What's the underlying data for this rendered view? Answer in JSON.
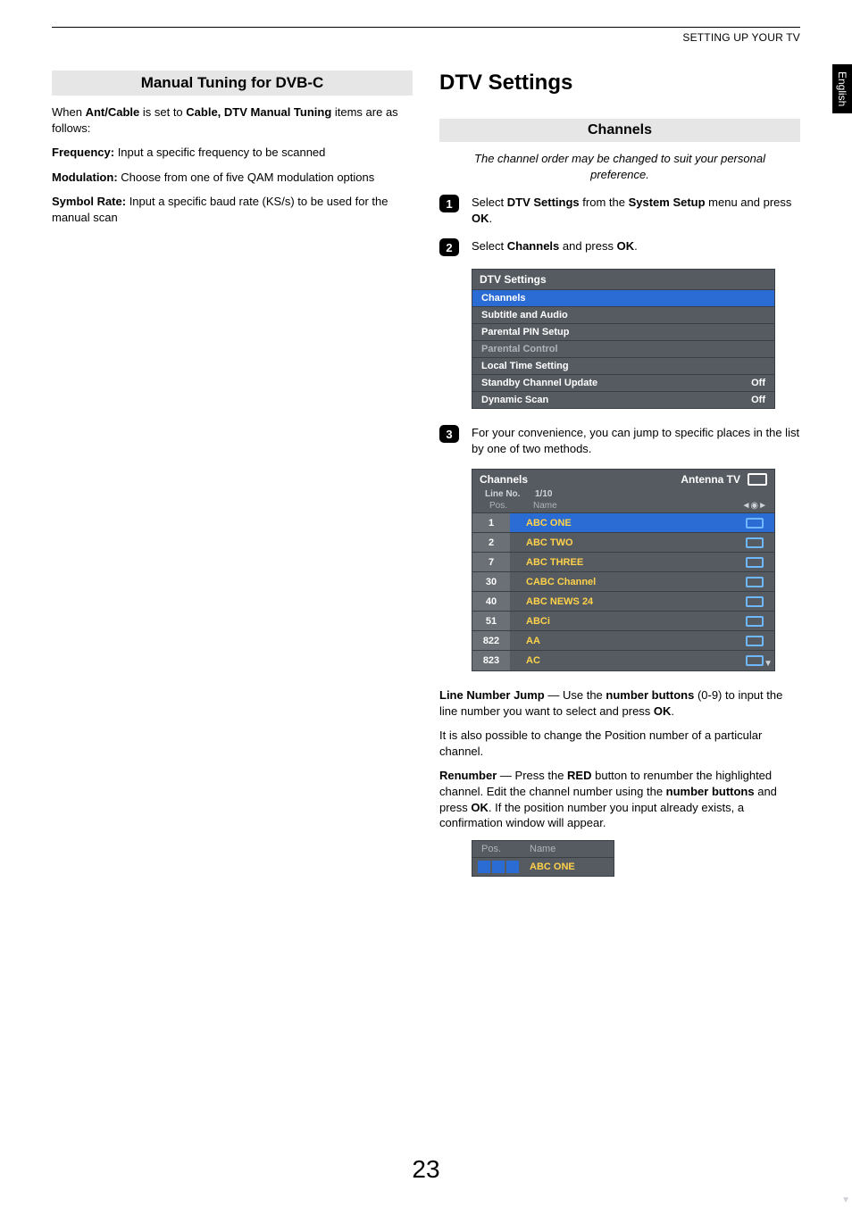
{
  "running_head": "SETTING UP YOUR TV",
  "lang_tab": "English",
  "page_number": "23",
  "left": {
    "section_title": "Manual Tuning for DVB-C",
    "intro_a": "When ",
    "intro_b": "Ant/Cable",
    "intro_c": " is set to ",
    "intro_d": "Cable, DTV Manual Tuning",
    "intro_e": " items are as follows:",
    "freq_label": "Frequency:",
    "freq_text": " Input a specific frequency to be scanned",
    "mod_label": "Modulation:",
    "mod_text": " Choose from one of five QAM modulation options",
    "sym_label": "Symbol Rate:",
    "sym_text": " Input a specific baud rate (KS/s) to be used for the manual scan"
  },
  "right": {
    "h1": "DTV Settings",
    "channels_title": "Channels",
    "intro_italic": "The channel order may be changed to suit your personal preference.",
    "step1_a": "Select ",
    "step1_b": "DTV Settings",
    "step1_c": " from the ",
    "step1_d": "System Setup",
    "step1_e": " menu and press ",
    "step1_f": "OK",
    "step1_g": ".",
    "step2_a": "Select ",
    "step2_b": "Channels",
    "step2_c": " and press ",
    "step2_d": "OK",
    "step2_e": ".",
    "osd1": {
      "title": "DTV Settings",
      "rows": [
        {
          "label": "Channels",
          "value": "",
          "sel": true
        },
        {
          "label": "Subtitle and Audio",
          "value": ""
        },
        {
          "label": "Parental PIN Setup",
          "value": ""
        },
        {
          "label": "Parental Control",
          "value": "",
          "dim": true
        },
        {
          "label": "Local Time Setting",
          "value": ""
        },
        {
          "label": "Standby Channel Update",
          "value": "Off"
        },
        {
          "label": "Dynamic Scan",
          "value": "Off"
        }
      ]
    },
    "step3_text": "For your convenience, you can jump to specific places in the list by one of two methods.",
    "osd2": {
      "title_left": "Channels",
      "title_right": "Antenna TV",
      "line_no_label": "Line No.",
      "line_no_value": "1/10",
      "col_pos": "Pos.",
      "col_name": "Name",
      "rows": [
        {
          "pos": "1",
          "name": "ABC ONE",
          "sel": true
        },
        {
          "pos": "2",
          "name": "ABC TWO"
        },
        {
          "pos": "7",
          "name": "ABC THREE"
        },
        {
          "pos": "30",
          "name": "CABC Channel"
        },
        {
          "pos": "40",
          "name": "ABC NEWS 24"
        },
        {
          "pos": "51",
          "name": "ABCi"
        },
        {
          "pos": "822",
          "name": "AA"
        },
        {
          "pos": "823",
          "name": "AC"
        }
      ]
    },
    "lnj_label": "Line Number Jump",
    "lnj_a": " — Use the ",
    "lnj_b": "number buttons",
    "lnj_c": " (0-9) to input the line number you want to select and press ",
    "lnj_d": "OK",
    "lnj_e": ".",
    "pos_change": "It is also possible to change the Position number of a particular channel.",
    "ren_label": "Renumber",
    "ren_a": " — Press the ",
    "ren_b": "RED",
    "ren_c": " button to renumber the highlighted channel. Edit the channel number using the ",
    "ren_d": "number buttons",
    "ren_e": " and press ",
    "ren_f": "OK",
    "ren_g": ". If the position number you input already exists, a confirmation window will appear.",
    "osd3": {
      "col_pos": "Pos.",
      "col_name": "Name",
      "name": "ABC ONE"
    }
  }
}
